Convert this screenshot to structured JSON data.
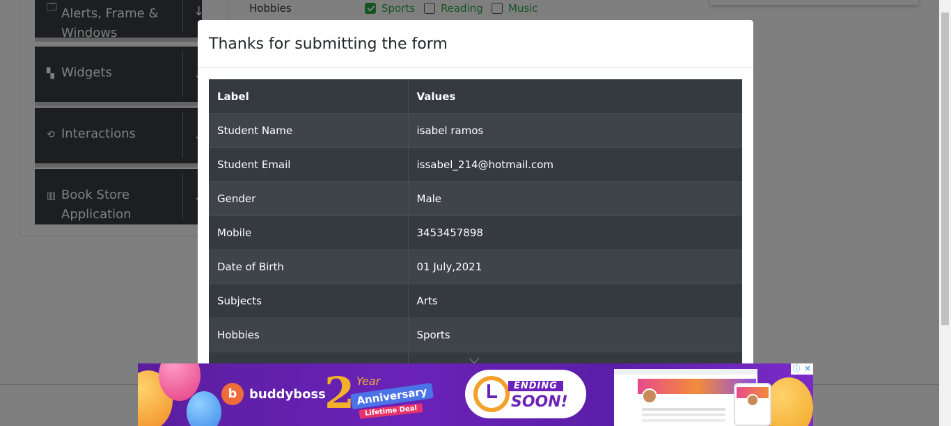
{
  "sidebar": {
    "groups": [
      {
        "label": "Alerts, Frame & Windows",
        "icon": "window-icon"
      },
      {
        "label": "Widgets",
        "icon": "widgets-icon"
      },
      {
        "label": "Interactions",
        "icon": "interactions-icon"
      },
      {
        "label": "Book Store Application",
        "icon": "books-icon"
      }
    ]
  },
  "form": {
    "hobbies_label": "Hobbies",
    "hobbies": [
      {
        "label": "Sports",
        "checked": true
      },
      {
        "label": "Reading",
        "checked": false
      },
      {
        "label": "Music",
        "checked": false
      }
    ]
  },
  "modal": {
    "title": "Thanks for submitting the form",
    "table": {
      "headers": [
        "Label",
        "Values"
      ],
      "rows": [
        [
          "Student Name",
          "isabel ramos"
        ],
        [
          "Student Email",
          "issabel_214@hotmail.com"
        ],
        [
          "Gender",
          "Male"
        ],
        [
          "Mobile",
          "3453457898"
        ],
        [
          "Date of Birth",
          "01 July,2021"
        ],
        [
          "Subjects",
          "Arts"
        ],
        [
          "Hobbies",
          "Sports"
        ],
        [
          "",
          ""
        ]
      ]
    }
  },
  "ad": {
    "brand": "buddyboss",
    "anniversary_number": "2",
    "anniversary_year": "Year",
    "anniversary_label": "Anniversary",
    "deal": "Lifetime Deal",
    "ending": "ENDING",
    "soon": "SOON!",
    "info_icon": "ⓘ",
    "close_icon": "✕"
  },
  "colors": {
    "accent_green": "#28a745",
    "table_dark": "#343a40",
    "table_stripe": "#3e444a",
    "ad_purple": "#6a22b8"
  }
}
